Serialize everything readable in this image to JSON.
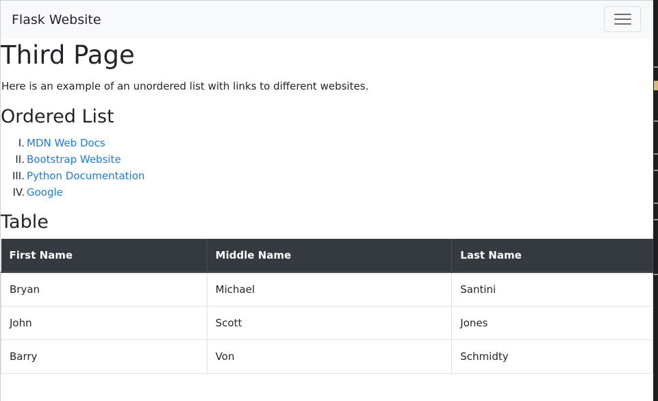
{
  "navbar": {
    "brand": "Flask Website",
    "toggler_icon": "hamburger-menu-icon"
  },
  "page": {
    "title": "Third Page",
    "intro": "Here is an example of an unordered list with links to different websites."
  },
  "ordered_list": {
    "heading": "Ordered List",
    "items": [
      {
        "num": "I.",
        "label": "MDN Web Docs"
      },
      {
        "num": "II.",
        "label": "Bootstrap Website"
      },
      {
        "num": "III.",
        "label": "Python Documentation"
      },
      {
        "num": "IV.",
        "label": "Google"
      }
    ]
  },
  "table": {
    "heading": "Table",
    "columns": [
      "First Name",
      "Middle Name",
      "Last Name"
    ],
    "rows": [
      [
        "Bryan",
        "Michael",
        "Santini"
      ],
      [
        "John",
        "Scott",
        "Jones"
      ],
      [
        "Barry",
        "Von",
        "Schmidty"
      ]
    ]
  },
  "colors": {
    "navbar_bg": "#f8f9fa",
    "link": "#1f7ae0",
    "table_header_bg": "#343a40"
  }
}
